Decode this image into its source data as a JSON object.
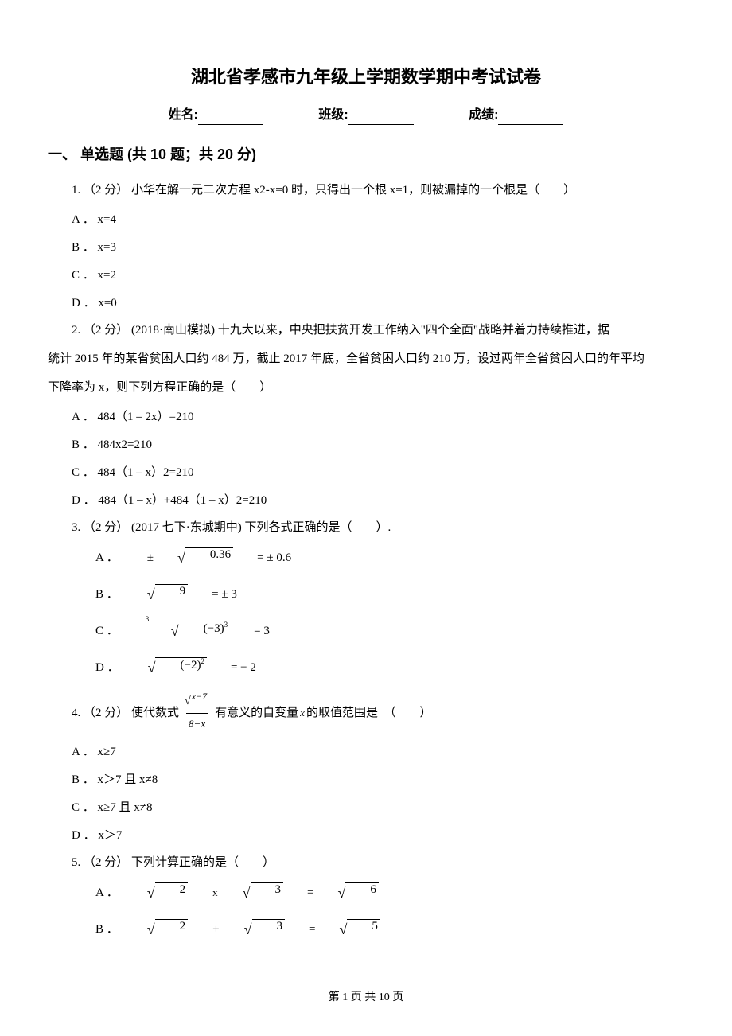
{
  "title": "湖北省孝感市九年级上学期数学期中考试试卷",
  "info": {
    "name_label": "姓名:",
    "class_label": "班级:",
    "score_label": "成绩:"
  },
  "section1": {
    "heading": "一、 单选题 (共 10 题；共 20 分)"
  },
  "q1": {
    "stem": "1.  （2 分）  小华在解一元二次方程 x2-x=0 时，只得出一个根 x=1，则被漏掉的一个根是（　　）",
    "A": "A ．  x=4",
    "B": "B ．  x=3",
    "C": "C ．  x=2",
    "D": "D ．  x=0"
  },
  "q2": {
    "stem_a": "2.  （2 分）  (2018·南山模拟) 十九大以来，中央把扶贫开发工作纳入\"四个全面\"战略并着力持续推进，据",
    "stem_b": "统计 2015 年的某省贫困人口约 484 万，截止 2017 年底，全省贫困人口约 210 万，设过两年全省贫困人口的年平均",
    "stem_c": "下降率为 x，则下列方程正确的是（　　）",
    "A": "A ．  484（1 – 2x）=210",
    "B": "B ．  484x2=210",
    "C": "C ．  484（1 – x）2=210",
    "D": "D ．  484（1 – x）+484（1 – x）2=210"
  },
  "q3": {
    "stem": "3.  （2 分）  (2017 七下·东城期中) 下列各式正确的是（　　）.",
    "A_label": "A ．",
    "B_label": "B ．",
    "C_label": "C ．",
    "D_label": "D ．",
    "A_eq_pre": "±",
    "A_eq_rad": "0.36",
    "A_eq_post": " = ± 0.6",
    "B_eq_rad": "9",
    "B_eq_post": " = ± 3",
    "C_idx": "3",
    "C_base": "(−3)",
    "C_exp": "3",
    "C_post": " = 3",
    "D_base": "(−2)",
    "D_exp": "2",
    "D_post": " = − 2"
  },
  "q4": {
    "pre": "4.  （2 分）  使代数式",
    "num_rad": "x−7",
    "den": "8−x",
    "post1": "有意义的自变量",
    "xvar": "x",
    "post2": "的取值范围是　（　　）",
    "A": "A ．  x≥7",
    "B": "B ．  x＞7 且 x≠8",
    "C": "C ．  x≥7 且 x≠8",
    "D": "D ．  x＞7"
  },
  "q5": {
    "stem": "5.  （2 分）  下列计算正确的是（　　）",
    "A_label": "A ．",
    "A_r1": "2",
    "A_op": "x",
    "A_r2": "3",
    "A_eq": "=",
    "A_r3": "6",
    "B_label": "B ．",
    "B_r1": "2",
    "B_op": "+",
    "B_r2": "3",
    "B_eq": "=",
    "B_r3": "5"
  },
  "footer": "第 1 页 共 10 页"
}
